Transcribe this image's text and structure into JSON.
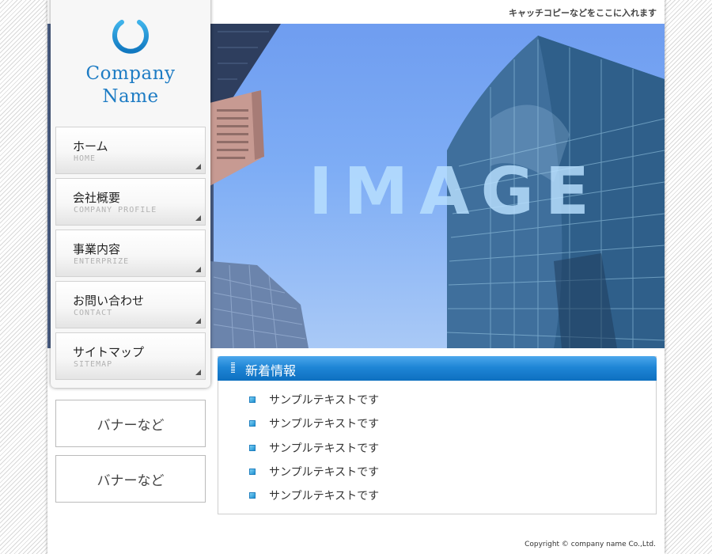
{
  "header": {
    "tagline": "キャッチコピーなどをここに入れます"
  },
  "logo": {
    "icon": "power-icon",
    "line1": "Company",
    "line2": "Name"
  },
  "hero": {
    "text": "IMAGE"
  },
  "nav": [
    {
      "ja": "ホーム",
      "en": "HOME"
    },
    {
      "ja": "会社概要",
      "en": "COMPANY PROFILE"
    },
    {
      "ja": "事業内容",
      "en": "ENTERPRIZE"
    },
    {
      "ja": "お問い合わせ",
      "en": "CONTACT"
    },
    {
      "ja": "サイトマップ",
      "en": "SITEMAP"
    }
  ],
  "banners": [
    "バナーなど",
    "バナーなど"
  ],
  "news": {
    "title": "新着情報",
    "items": [
      "サンプルテキストです",
      "サンプルテキストです",
      "サンプルテキストです",
      "サンプルテキストです",
      "サンプルテキストです"
    ]
  },
  "footer": {
    "copyright": "Copyright © company name Co.,Ltd."
  },
  "colors": {
    "accent": "#1e7cc4",
    "news_header": "#1f86d6"
  }
}
